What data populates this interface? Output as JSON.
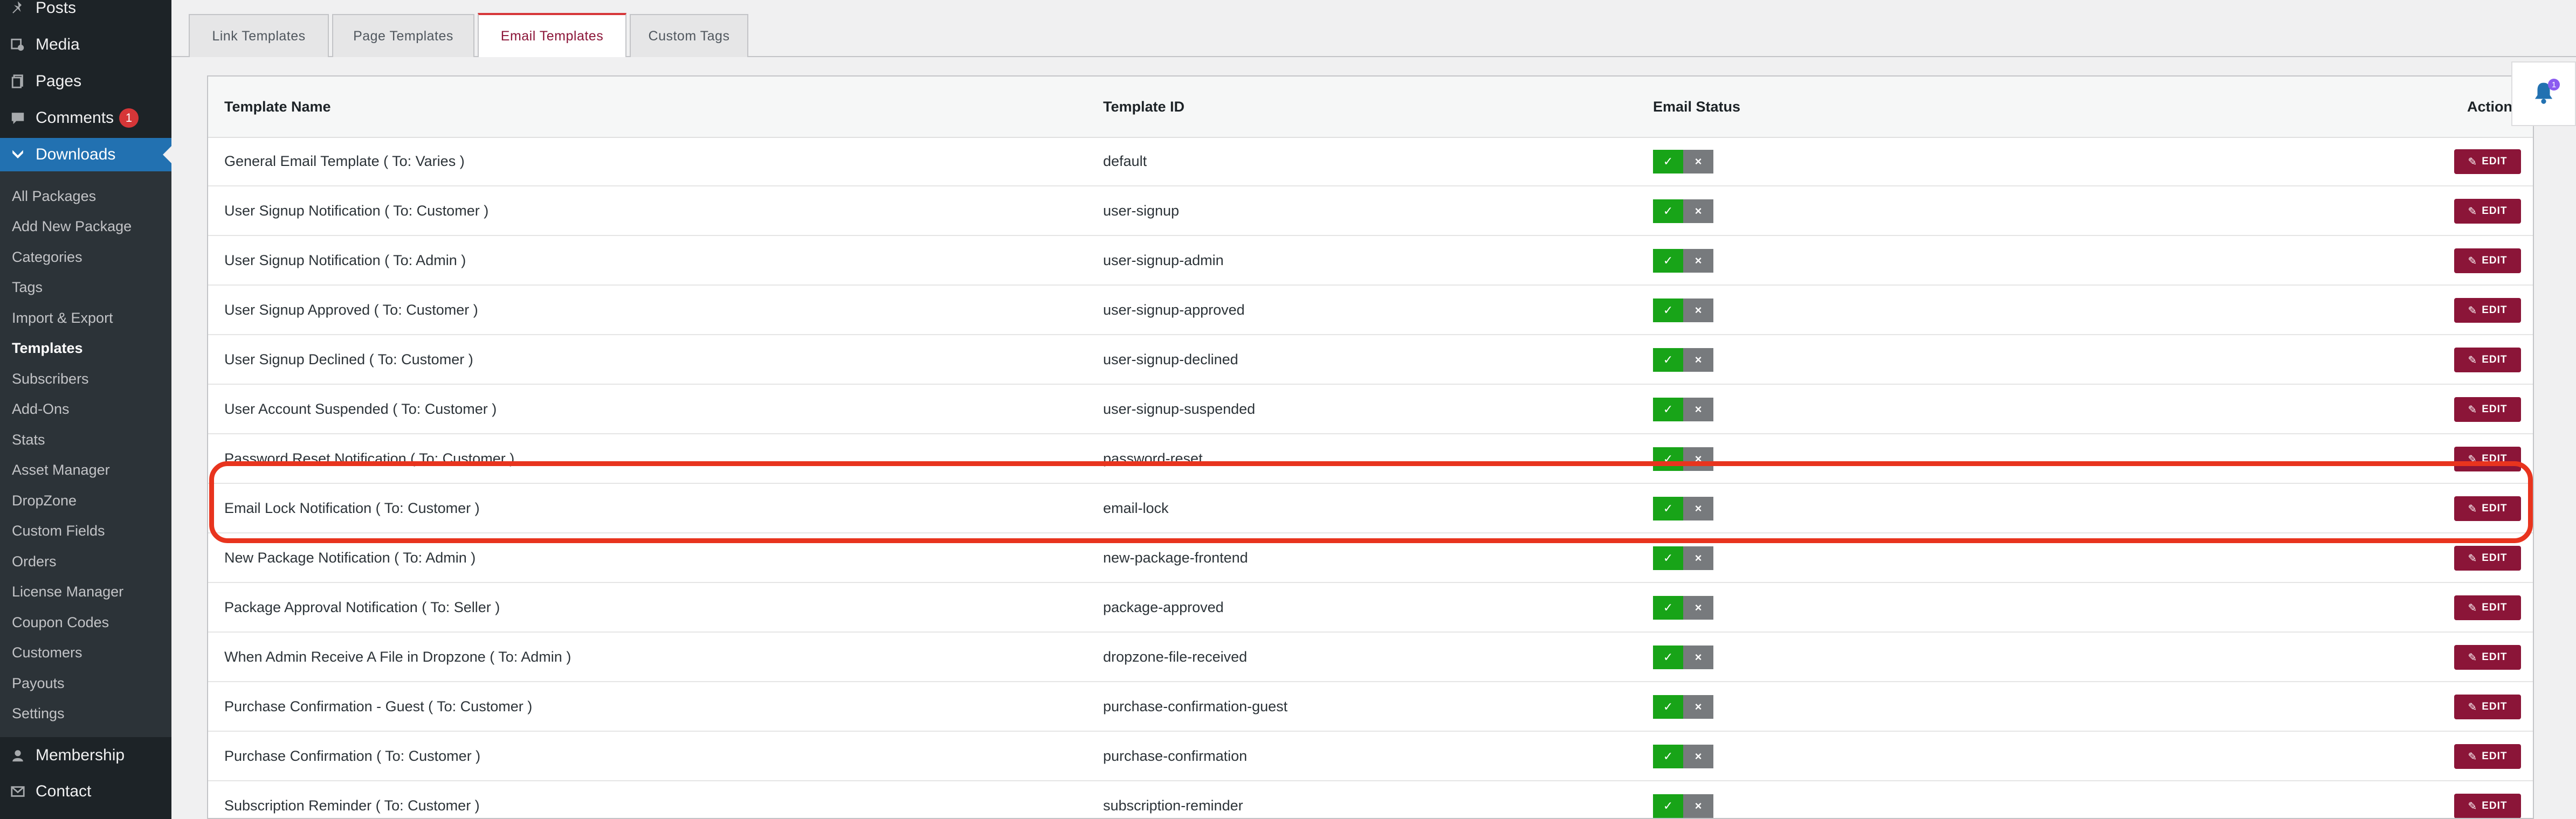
{
  "sidebar": {
    "top_items": [
      {
        "label": "Posts",
        "icon": "pin-icon"
      },
      {
        "label": "Media",
        "icon": "media-icon"
      },
      {
        "label": "Pages",
        "icon": "pages-icon"
      },
      {
        "label": "Comments",
        "icon": "comment-icon",
        "badge": "1"
      },
      {
        "label": "Downloads",
        "icon": "download-icon",
        "active": true
      }
    ],
    "submenu": [
      "All Packages",
      "Add New Package",
      "Categories",
      "Tags",
      "Import & Export",
      "Templates",
      "Subscribers",
      "Add-Ons",
      "Stats",
      "Asset Manager",
      "DropZone",
      "Custom Fields",
      "Orders",
      "License Manager",
      "Coupon Codes",
      "Customers",
      "Payouts",
      "Settings"
    ],
    "current_submenu": "Templates",
    "bottom_items": [
      {
        "label": "Membership",
        "icon": "membership-icon"
      },
      {
        "label": "Contact",
        "icon": "mail-icon"
      }
    ]
  },
  "tabs": [
    {
      "label": "Link Templates"
    },
    {
      "label": "Page Templates"
    },
    {
      "label": "Email Templates",
      "active": true
    },
    {
      "label": "Custom Tags"
    }
  ],
  "table": {
    "headers": {
      "name": "Template Name",
      "id": "Template ID",
      "status": "Email Status",
      "action": "Action"
    },
    "edit_label": "EDIT",
    "status_on_symbol": "✓",
    "status_off_symbol": "×",
    "rows": [
      {
        "name": "General Email Template ( To: Varies )",
        "id": "default"
      },
      {
        "name": "User Signup Notification ( To: Customer )",
        "id": "user-signup"
      },
      {
        "name": "User Signup Notification ( To: Admin )",
        "id": "user-signup-admin"
      },
      {
        "name": "User Signup Approved ( To: Customer )",
        "id": "user-signup-approved"
      },
      {
        "name": "User Signup Declined ( To: Customer )",
        "id": "user-signup-declined"
      },
      {
        "name": "User Account Suspended ( To: Customer )",
        "id": "user-signup-suspended"
      },
      {
        "name": "Password Reset Notification ( To: Customer )",
        "id": "password-reset"
      },
      {
        "name": "Email Lock Notification ( To: Customer )",
        "id": "email-lock"
      },
      {
        "name": "New Package Notification ( To: Admin )",
        "id": "new-package-frontend"
      },
      {
        "name": "Package Approval Notification ( To: Seller )",
        "id": "package-approved"
      },
      {
        "name": "When Admin Receive A File in Dropzone ( To: Admin )",
        "id": "dropzone-file-received"
      },
      {
        "name": "Purchase Confirmation - Guest ( To: Customer )",
        "id": "purchase-confirmation-guest"
      },
      {
        "name": "Purchase Confirmation ( To: Customer )",
        "id": "purchase-confirmation"
      },
      {
        "name": "Subscription Reminder ( To: Customer )",
        "id": "subscription-reminder"
      }
    ]
  },
  "notification": {
    "count": "1"
  },
  "colors": {
    "accent": "#8b1538",
    "highlight": "#e8341e",
    "status_on": "#18a418",
    "admin_blue": "#2271b1"
  }
}
